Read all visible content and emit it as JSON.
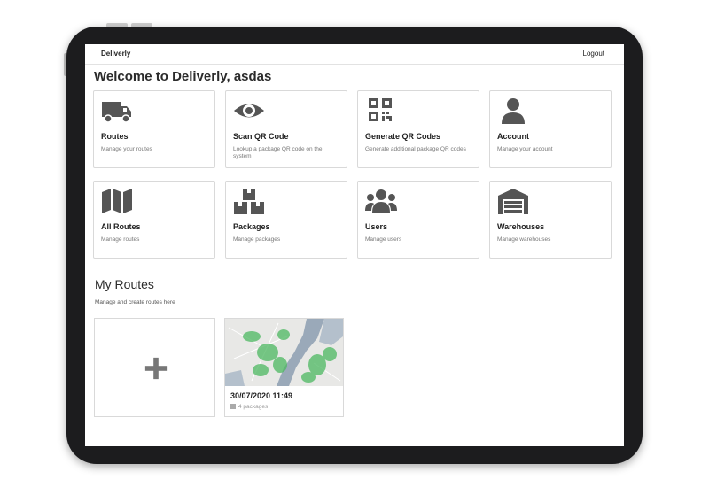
{
  "app": {
    "brand": "Deliverly",
    "logout_label": "Logout"
  },
  "welcome": "Welcome to Deliverly, asdas",
  "cards": [
    {
      "title": "Routes",
      "desc": "Manage your routes",
      "icon": "truck-icon"
    },
    {
      "title": "Scan QR Code",
      "desc": "Lookup a package QR code on the system",
      "icon": "eye-icon"
    },
    {
      "title": "Generate QR Codes",
      "desc": "Generate additional package QR codes",
      "icon": "qr-code-icon"
    },
    {
      "title": "Account",
      "desc": "Manage your account",
      "icon": "user-icon"
    },
    {
      "title": "All Routes",
      "desc": "Manage routes",
      "icon": "map-icon"
    },
    {
      "title": "Packages",
      "desc": "Manage packages",
      "icon": "boxes-icon"
    },
    {
      "title": "Users",
      "desc": "Manage users",
      "icon": "users-icon"
    },
    {
      "title": "Warehouses",
      "desc": "Manage warehouses",
      "icon": "warehouse-icon"
    }
  ],
  "my_routes": {
    "title": "My Routes",
    "subtitle": "Manage and create routes here",
    "add_icon": "plus-icon",
    "routes": [
      {
        "date": "30/07/2020 11:49",
        "packages": "4 packages",
        "icon": "box-icon"
      }
    ]
  },
  "colors": {
    "icon": "#555555",
    "map_water": "#9aa9b9",
    "map_land": "#e8e8e6",
    "map_route": "#4db861"
  }
}
